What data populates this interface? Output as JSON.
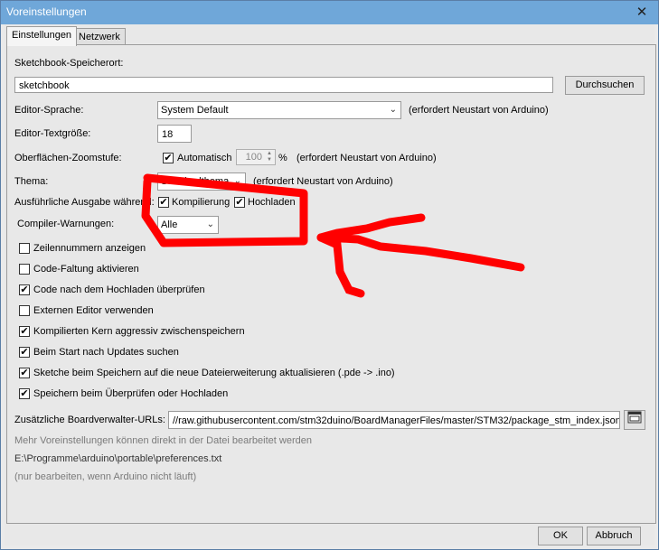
{
  "window": {
    "title": "Voreinstellungen",
    "close_glyph": "✕"
  },
  "tabs": [
    "Einstellungen",
    "Netzwerk"
  ],
  "sketchbook": {
    "label": "Sketchbook-Speicherort:",
    "value": "sketchbook",
    "browse": "Durchsuchen"
  },
  "editor_language": {
    "label": "Editor-Sprache:",
    "value": "System Default",
    "note": "(erfordert Neustart von Arduino)"
  },
  "text_size": {
    "label": "Editor-Textgröße:",
    "value": "18"
  },
  "zoom": {
    "label": "Oberflächen-Zoomstufe:",
    "auto_label": "Automatisch",
    "value": "100",
    "unit": "%",
    "note": "(erfordert Neustart von Arduino)"
  },
  "theme": {
    "label": "Thema:",
    "value": "Standardthema",
    "note": "(erfordert Neustart von Arduino)"
  },
  "verbose": {
    "label": "Ausführliche Ausgabe während:",
    "compile": "Kompilierung",
    "upload": "Hochladen"
  },
  "warnings": {
    "label": "Compiler-Warnungen:",
    "value": "Alle"
  },
  "options": [
    {
      "label": "Zeilennummern anzeigen",
      "checked": false
    },
    {
      "label": "Code-Faltung aktivieren",
      "checked": false
    },
    {
      "label": "Code nach dem Hochladen überprüfen",
      "checked": true
    },
    {
      "label": "Externen Editor verwenden",
      "checked": false
    },
    {
      "label": "Kompilierten Kern aggressiv zwischenspeichern",
      "checked": true
    },
    {
      "label": "Beim Start nach Updates suchen",
      "checked": true
    },
    {
      "label": "Sketche beim Speichern auf die neue Dateierweiterung aktualisieren (.pde -> .ino)",
      "checked": true
    },
    {
      "label": "Speichern beim Überprüfen oder Hochladen",
      "checked": true
    }
  ],
  "board_urls": {
    "label": "Zusätzliche Boardverwalter-URLs:",
    "value": "//raw.githubusercontent.com/stm32duino/BoardManagerFiles/master/STM32/package_stm_index.json"
  },
  "footer": {
    "more": "Mehr Voreinstellungen können direkt in der Datei bearbeitet werden",
    "path": "E:\\Programme\\arduino\\portable\\preferences.txt",
    "note": "(nur bearbeiten, wenn Arduino nicht läuft)"
  },
  "buttons": {
    "ok": "OK",
    "cancel": "Abbruch"
  },
  "colors": {
    "titlebar": "#6fa7d9",
    "annotation": "#ff0000"
  }
}
